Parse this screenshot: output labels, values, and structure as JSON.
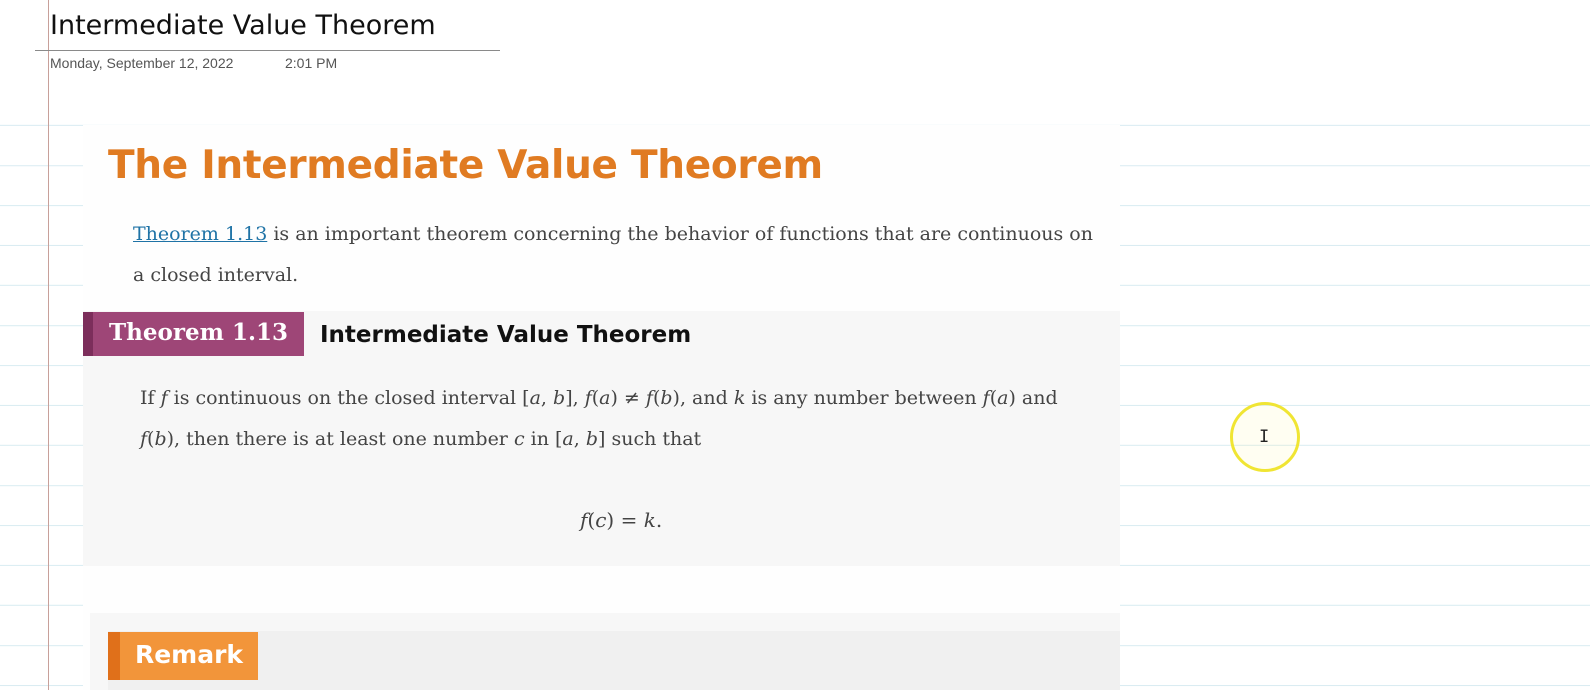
{
  "page": {
    "title": "Intermediate Value Theorem",
    "date": "Monday, September 12, 2022",
    "time": "2:01 PM"
  },
  "content": {
    "heading": "The Intermediate Value Theorem",
    "intro_link": "Theorem 1.13",
    "intro_text": " is an important theorem concerning the behavior of functions that are continuous on a closed interval.",
    "theorem": {
      "tag": "Theorem 1.13",
      "name": "Intermediate Value Theorem",
      "statement": {
        "t1": "If ",
        "f1": "f",
        "t2": " is continuous on the closed interval [",
        "a1": "a",
        "c1": ", ",
        "b1": "b",
        "t3": "], ",
        "f2": "f",
        "t4": "(",
        "a2": "a",
        "t5": ") ≠ ",
        "f3": "f",
        "t6": "(",
        "b2": "b",
        "t7": "), and ",
        "k1": "k",
        "t8": " is any number between ",
        "f4": "f",
        "t9": "(",
        "a3": "a",
        "t10": ") and ",
        "f5": "f",
        "t11": "(",
        "b3": "b",
        "t12": "), then there is at least one number ",
        "c2": "c",
        "t13": " in [",
        "a4": "a",
        "c3": ", ",
        "b4": "b",
        "t14": "] such that"
      },
      "equation": {
        "f": "f",
        "open": "(",
        "c": "c",
        "close": ") = ",
        "k": "k",
        "end": "."
      }
    },
    "remark": {
      "tag": "Remark"
    }
  },
  "icons": {
    "cursor": "ibeam-cursor-icon",
    "highlight": "cursor-highlight-ring"
  },
  "colors": {
    "heading": "#e07b22",
    "link": "#1f73a6",
    "theorem_tag": "#9e4677",
    "remark_tag": "#f2953a",
    "cursor_ring": "#f0e533"
  }
}
